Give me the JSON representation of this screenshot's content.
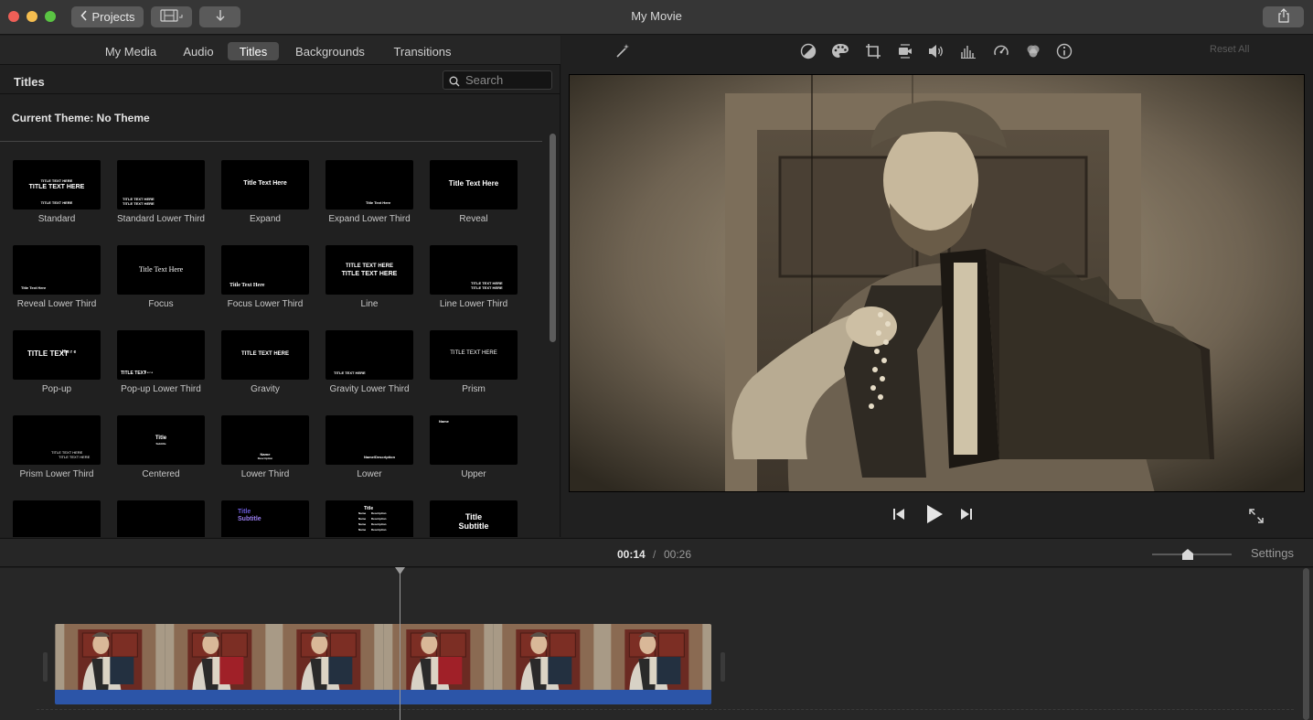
{
  "window": {
    "title": "My Movie"
  },
  "toolbar": {
    "projects_label": "Projects"
  },
  "browser": {
    "tabs": [
      {
        "label": "My Media"
      },
      {
        "label": "Audio"
      },
      {
        "label": "Titles"
      },
      {
        "label": "Backgrounds"
      },
      {
        "label": "Transitions"
      }
    ],
    "active_tab": "Titles",
    "section_title": "Titles",
    "search_placeholder": "Search",
    "theme_line": "Current Theme: No Theme",
    "tiles": [
      {
        "label": "Standard",
        "preview": [
          "TITLE TEXT HERE",
          "TITLE TEXT HERE",
          "TITLE TEXT HERE"
        ]
      },
      {
        "label": "Standard Lower Third",
        "preview": [
          "TITLE TEXT HERE",
          "TITLE TEXT HERE"
        ]
      },
      {
        "label": "Expand",
        "preview": [
          "Title Text Here"
        ]
      },
      {
        "label": "Expand Lower Third",
        "preview": [
          "Title Text Here"
        ]
      },
      {
        "label": "Reveal",
        "preview": [
          "Title Text Here"
        ]
      },
      {
        "label": "Reveal Lower Third",
        "preview": [
          "Title Text Here"
        ]
      },
      {
        "label": "Focus",
        "preview": [
          "Title Text Here"
        ]
      },
      {
        "label": "Focus Lower Third",
        "preview": [
          "Title Text Here"
        ]
      },
      {
        "label": "Line",
        "preview": [
          "TITLE TEXT HERE",
          "TITLE TEXT HERE"
        ]
      },
      {
        "label": "Line Lower Third",
        "preview": [
          "TITLE TEXT HERE",
          "TITLE TEXT HERE"
        ]
      },
      {
        "label": "Pop-up",
        "preview": [
          "TITLE TEXT",
          "H e r e"
        ]
      },
      {
        "label": "Pop-up Lower Third",
        "preview": [
          "TITLE TEXT",
          "H e r e"
        ]
      },
      {
        "label": "Gravity",
        "preview": [
          "TITLE TEXT HERE"
        ]
      },
      {
        "label": "Gravity Lower Third",
        "preview": [
          "TITLE TEXT HERE"
        ]
      },
      {
        "label": "Prism",
        "preview": [
          "TITLE TEXT HERE"
        ]
      },
      {
        "label": "Prism Lower Third",
        "preview": [
          "TITLE TEXT HERE",
          "TITLE TEXT HERE"
        ]
      },
      {
        "label": "Centered",
        "preview": [
          "Title",
          "Subtitle"
        ]
      },
      {
        "label": "Lower Third",
        "preview": [
          "Name",
          "Description"
        ]
      },
      {
        "label": "Lower",
        "preview": [
          "Name/Description"
        ]
      },
      {
        "label": "Upper",
        "preview": [
          "Name"
        ]
      },
      {
        "label": "",
        "preview": []
      },
      {
        "label": "",
        "preview": []
      },
      {
        "label": "",
        "preview": [
          "Title",
          "Subtitle"
        ]
      },
      {
        "label": "",
        "preview": [
          "Title",
          "Name",
          "Description",
          "Name",
          "Description",
          "Name",
          "Description",
          "Name",
          "Description"
        ]
      },
      {
        "label": "",
        "preview": [
          "Title",
          "Subtitle"
        ]
      }
    ]
  },
  "viewer": {
    "reset_all": "Reset All",
    "tools": [
      "magic-wand-icon",
      "color-balance-icon",
      "color-correction-icon",
      "crop-icon",
      "stabilization-icon",
      "volume-icon",
      "noise-reduction-icon",
      "speed-icon",
      "clip-filter-icon",
      "info-icon"
    ]
  },
  "timeline": {
    "current_time": "00:14",
    "separator": "/",
    "total_time": "00:26",
    "settings_label": "Settings",
    "zoom_level": 0.45,
    "frames": 6
  },
  "colors": {
    "accent_blue": "#2c55a8",
    "bg_dark": "#1e1e1e",
    "title_bar": "#363636"
  }
}
